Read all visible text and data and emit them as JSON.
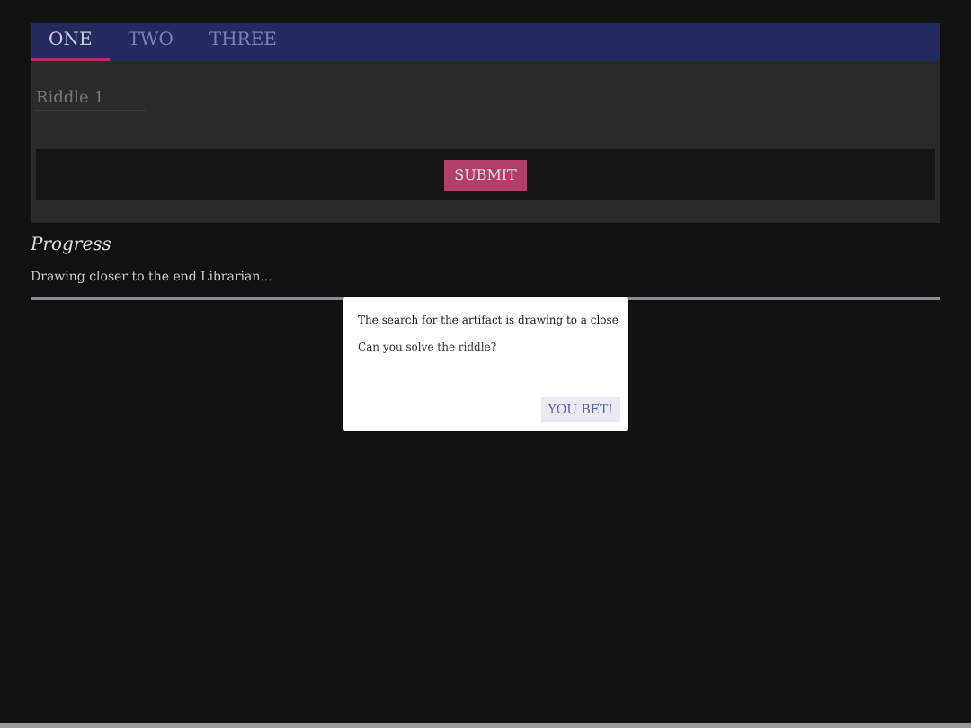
{
  "tabs": [
    {
      "label": "ONE",
      "selected": true
    },
    {
      "label": "TWO",
      "selected": false
    },
    {
      "label": "THREE",
      "selected": false
    }
  ],
  "field": {
    "placeholder": "Riddle 1"
  },
  "submit_button": "SUBMIT",
  "progress": {
    "title": "Progress",
    "message": "Drawing closer to the end Librarian...",
    "level": 1
  },
  "dialog": {
    "title": "The search for the artifact is drawing to a close",
    "body": "Can you solve the riddle?",
    "button": "YOU BET!"
  }
}
